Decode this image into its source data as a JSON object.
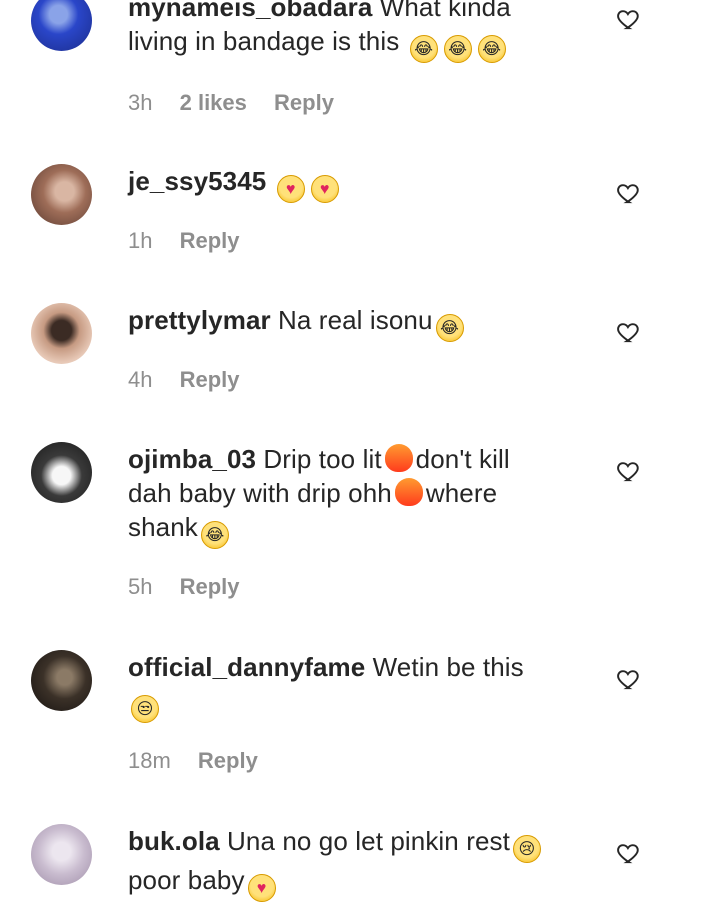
{
  "comments": [
    {
      "username": "mynameis_obadara",
      "segments": [
        "What kinda",
        "living in bandage is this"
      ],
      "emojis": [
        "laugh",
        "laugh",
        "laugh"
      ],
      "time": "3h",
      "likes": "2 likes",
      "reply": "Reply"
    },
    {
      "username": "je_ssy5345",
      "emojis": [
        "heart-eyes",
        "heart-eyes"
      ],
      "time": "1h",
      "reply": "Reply"
    },
    {
      "username": "prettylymar",
      "text": "Na real isonu",
      "emojis": [
        "laugh"
      ],
      "time": "4h",
      "reply": "Reply"
    },
    {
      "username": "ojimba_03",
      "segments": [
        "Drip too lit",
        "don't kill",
        "dah baby with drip ohh",
        "where",
        "shank"
      ],
      "emojis": [
        "fire",
        "fire",
        "laugh"
      ],
      "time": "5h",
      "reply": "Reply"
    },
    {
      "username": "official_dannyfame",
      "text": "Wetin be this",
      "emojis": [
        "unamused"
      ],
      "time": "18m",
      "reply": "Reply"
    },
    {
      "username": "buk.ola",
      "segments": [
        "Una no go let pinkin rest",
        "poor baby"
      ],
      "emojis": [
        "cry",
        "heart-eyes"
      ],
      "time": "",
      "reply": ""
    }
  ]
}
